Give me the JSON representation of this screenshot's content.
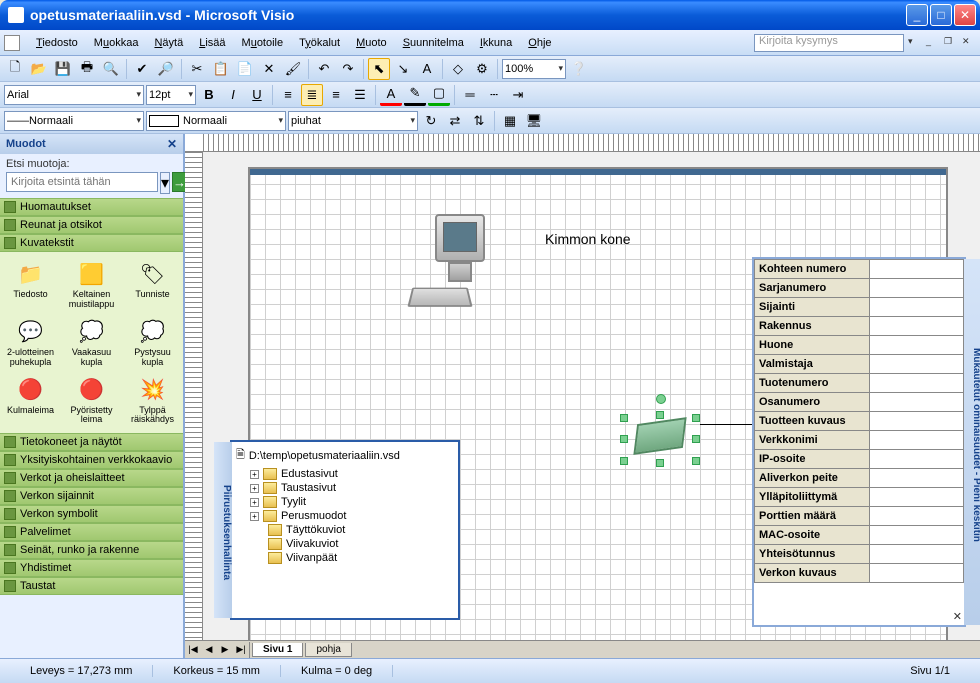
{
  "title": "opetusmateriaaliin.vsd - Microsoft Visio",
  "menu": [
    "Tiedosto",
    "Muokkaa",
    "Näytä",
    "Lisää",
    "Muotoile",
    "Työkalut",
    "Muoto",
    "Suunnitelma",
    "Ikkuna",
    "Ohje"
  ],
  "askbox": "Kirjoita kysymys",
  "format": {
    "font": "Arial",
    "size": "12pt",
    "zoom": "100%",
    "line1": "Normaali",
    "line2": "Normaali",
    "layer": "piuhat"
  },
  "shapes_panel": {
    "title": "Muodot",
    "search_label": "Etsi muotoja:",
    "search_placeholder": "Kirjoita etsintä tähän",
    "open_stencils": [
      "Huomautukset",
      "Reunat ja otsikot",
      "Kuvatekstit"
    ],
    "masters": [
      {
        "label": "Tiedosto",
        "icon": "📁"
      },
      {
        "label": "Keltainen muistilappu",
        "icon": "🟨"
      },
      {
        "label": "Tunniste",
        "icon": "🏷"
      },
      {
        "label": "2-ulotteinen puhekupla",
        "icon": "💬"
      },
      {
        "label": "Vaakasuu kupla",
        "icon": "💭"
      },
      {
        "label": "Pystysuu kupla",
        "icon": "💭"
      },
      {
        "label": "Kulmaleima",
        "icon": "🔴"
      },
      {
        "label": "Pyöristetty leima",
        "icon": "🔴"
      },
      {
        "label": "Tylppä räiskähdys",
        "icon": "💥"
      }
    ],
    "closed_stencils": [
      "Tietokoneet ja näytöt",
      "Yksityiskohtainen verkkokaavio",
      "Verkot ja oheislaitteet",
      "Verkon sijainnit",
      "Verkon symbolit",
      "Palvelimet",
      "Seinät, runko ja rakenne",
      "Yhdistimet",
      "Taustat"
    ]
  },
  "canvas": {
    "label": "Kimmon kone"
  },
  "drawing_explorer": {
    "title": "Piirustuksenhallinta",
    "root": "D:\\temp\\opetusmateriaaliin.vsd",
    "nodes": [
      {
        "label": "Edustasivut",
        "exp": true
      },
      {
        "label": "Taustasivut",
        "exp": true
      },
      {
        "label": "Tyylit",
        "exp": true
      },
      {
        "label": "Perusmuodot",
        "exp": true
      },
      {
        "label": "Täyttökuviot",
        "exp": false
      },
      {
        "label": "Viivakuviot",
        "exp": false
      },
      {
        "label": "Viivanpäät",
        "exp": false
      }
    ]
  },
  "custom_props": {
    "title": "Mukautetut ominaisuudet - Pieni keskitin",
    "rows": [
      "Kohteen numero",
      "Sarjanumero",
      "Sijainti",
      "Rakennus",
      "Huone",
      "Valmistaja",
      "Tuotenumero",
      "Osanumero",
      "Tuotteen kuvaus",
      "Verkkonimi",
      "IP-osoite",
      "Aliverkon peite",
      "Ylläpitoliittymä",
      "Porttien määrä",
      "MAC-osoite",
      "Yhteisötunnus",
      "Verkon kuvaus"
    ]
  },
  "tabs": {
    "active": "Sivu 1",
    "inactive": "pohja"
  },
  "status": {
    "width": "Leveys = 17,273 mm",
    "height": "Korkeus = 15 mm",
    "angle": "Kulma = 0 deg",
    "page": "Sivu 1/1"
  }
}
